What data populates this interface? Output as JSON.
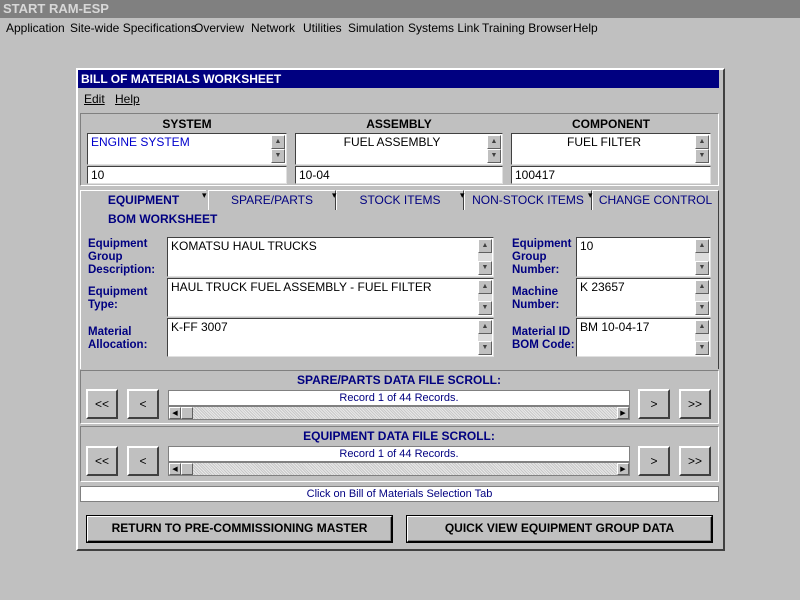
{
  "app": {
    "title": "START RAM-ESP",
    "menu": [
      "Application",
      "Site-wide Specifications",
      "Overview",
      "Network",
      "Utilities",
      "Simulation",
      "Systems Link",
      "Training Browser",
      "Help"
    ]
  },
  "window": {
    "title": "BILL OF MATERIALS WORKSHEET",
    "menu": {
      "edit": "Edit",
      "help": "Help"
    }
  },
  "selector": {
    "system": {
      "header": "SYSTEM",
      "name": "ENGINE SYSTEM",
      "code": "10"
    },
    "assembly": {
      "header": "ASSEMBLY",
      "name": "FUEL ASSEMBLY",
      "code": "10-04"
    },
    "component": {
      "header": "COMPONENT",
      "name": "FUEL FILTER",
      "code": "100417"
    }
  },
  "tabs": {
    "equipment": "EQUIPMENT",
    "spare_parts": "SPARE/PARTS",
    "stock_items": "STOCK ITEMS",
    "non_stock_items": "NON-STOCK ITEMS",
    "change_control": "CHANGE CONTROL"
  },
  "worksheet": {
    "title": "BOM WORKSHEET",
    "equipment_group_description": {
      "label": "Equipment Group Description:",
      "value": "KOMATSU HAUL TRUCKS"
    },
    "equipment_type": {
      "label": "Equipment Type:",
      "value": "HAUL TRUCK FUEL ASSEMBLY - FUEL FILTER"
    },
    "material_allocation": {
      "label": "Material Allocation:",
      "value": "K-FF 3007"
    },
    "equipment_group_number": {
      "label": "Equipment Group Number:",
      "value": "10"
    },
    "machine_number": {
      "label": "Machine Number:",
      "value": "K 23657"
    },
    "material_id_bom_code": {
      "label": "Material ID BOM Code:",
      "value": "BM 10-04-17"
    }
  },
  "spare_scroll": {
    "title": "SPARE/PARTS DATA FILE SCROLL:",
    "record": "Record 1 of 44 Records."
  },
  "equipment_scroll": {
    "title": "EQUIPMENT DATA FILE SCROLL:",
    "record": "Record 1 of 44 Records."
  },
  "nav": {
    "first": "<<",
    "prev": "<",
    "next": ">",
    "last": ">>"
  },
  "status": "Click on Bill of Materials Selection Tab",
  "buttons": {
    "return": "RETURN TO PRE-COMMISSIONING MASTER",
    "quick_view": "QUICK VIEW EQUIPMENT GROUP DATA"
  },
  "colors": {
    "title_bar": "#000080",
    "label_text": "#000080",
    "system_text": "#0000cc",
    "background": "#c0c0c0"
  }
}
